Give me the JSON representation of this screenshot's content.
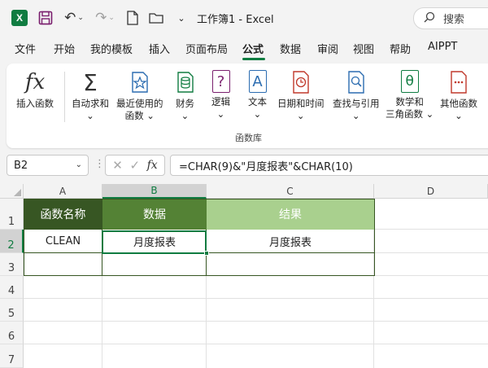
{
  "titlebar": {
    "logo_letter": "X",
    "title": "工作簿1  -  Excel",
    "search_placeholder": "搜索"
  },
  "tabs": [
    {
      "label": "文件"
    },
    {
      "label": "开始"
    },
    {
      "label": "我的模板"
    },
    {
      "label": "插入"
    },
    {
      "label": "页面布局"
    },
    {
      "label": "公式"
    },
    {
      "label": "数据"
    },
    {
      "label": "审阅"
    },
    {
      "label": "视图"
    },
    {
      "label": "帮助"
    },
    {
      "label": "AIPPT"
    }
  ],
  "active_tab": "公式",
  "ribbon": {
    "insert_function": {
      "icon_text": "fx",
      "label": "插入函数"
    },
    "autosum": {
      "label": "自动求和",
      "chevron": "⌄"
    },
    "recent": {
      "label1": "最近使用的",
      "label2": "函数",
      "chevron": "⌄"
    },
    "financial": {
      "label": "财务",
      "chevron": "⌄"
    },
    "logical": {
      "icon_text": "?",
      "label": "逻辑",
      "chevron": "⌄"
    },
    "text": {
      "icon_text": "A",
      "label": "文本",
      "chevron": "⌄"
    },
    "datetime": {
      "label": "日期和时间",
      "chevron": "⌄"
    },
    "lookup": {
      "label": "查找与引用",
      "chevron": "⌄"
    },
    "math": {
      "icon_text": "θ",
      "label1": "数学和",
      "label2": "三角函数 ⌄"
    },
    "other": {
      "label": "其他函数",
      "chevron": "⌄"
    },
    "group_label": "函数库"
  },
  "formula_bar": {
    "name_box": "B2",
    "formula": "=CHAR(9)&\"月度报表\"&CHAR(10)",
    "cancel_icon": "✕",
    "enter_icon": "✓",
    "fx_label": "fx"
  },
  "sheet": {
    "columns": [
      "A",
      "B",
      "C",
      "D"
    ],
    "rows": [
      "1",
      "2",
      "3",
      "4",
      "5",
      "6",
      "7"
    ],
    "selected_cell": "B2",
    "cells": {
      "A1": "函数名称",
      "B1": "数据",
      "C1": "结果",
      "A2": "CLEAN",
      "B2": "月度报表",
      "C2": "月度报表"
    }
  },
  "colors": {
    "accent": "#107c41",
    "header_dark": "#375623",
    "header_mid": "#548235",
    "header_light": "#a9d08e"
  }
}
